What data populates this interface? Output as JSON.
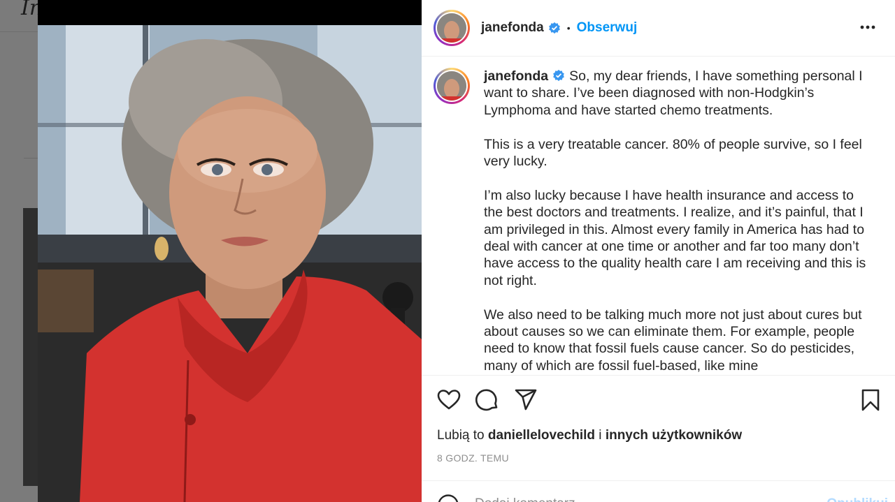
{
  "background": {
    "logo_text": "In"
  },
  "post": {
    "author": "janefonda",
    "follow_label": "Obserwuj",
    "separator": "•",
    "caption_intro": "So, my dear friends, I have something personal I want to share. I’ve been diagnosed with non-Hodgkin’s Lymphoma and have started chemo treatments.",
    "caption_paragraphs": [
      "This is a very treatable cancer. 80% of people survive, so I feel very lucky.",
      "I’m also lucky because I have health insurance and access to the best doctors and treatments. I realize, and it’s painful, that I am privileged in this. Almost every family in America has had to deal with cancer at one time or another and far too many don’t have access to the quality health care I am receiving and this is not right.",
      "We also need to be talking much more not just about cures but about causes so we can eliminate them. For example, people need to know that fossil fuels cause cancer. So do pesticides, many of which are fossil fuel-based, like mine"
    ],
    "likes_prefix": "Lubią to",
    "likes_user": "daniellelovechild",
    "likes_joiner": "i",
    "likes_others": "innych użytkowników",
    "timestamp": "8 GODZ. TEMU",
    "add_comment_placeholder": "Dodaj komentarz...",
    "publish_label": "Opublikuj"
  },
  "icons": {
    "more": "more-options-icon",
    "like": "heart-icon",
    "comment": "comment-icon",
    "share": "share-icon",
    "save": "bookmark-icon",
    "emoji": "emoji-icon",
    "verified": "verified-badge-icon"
  },
  "colors": {
    "link_blue": "#0095f6",
    "verified_blue": "#3897f0",
    "muted": "#8e8e8e"
  }
}
